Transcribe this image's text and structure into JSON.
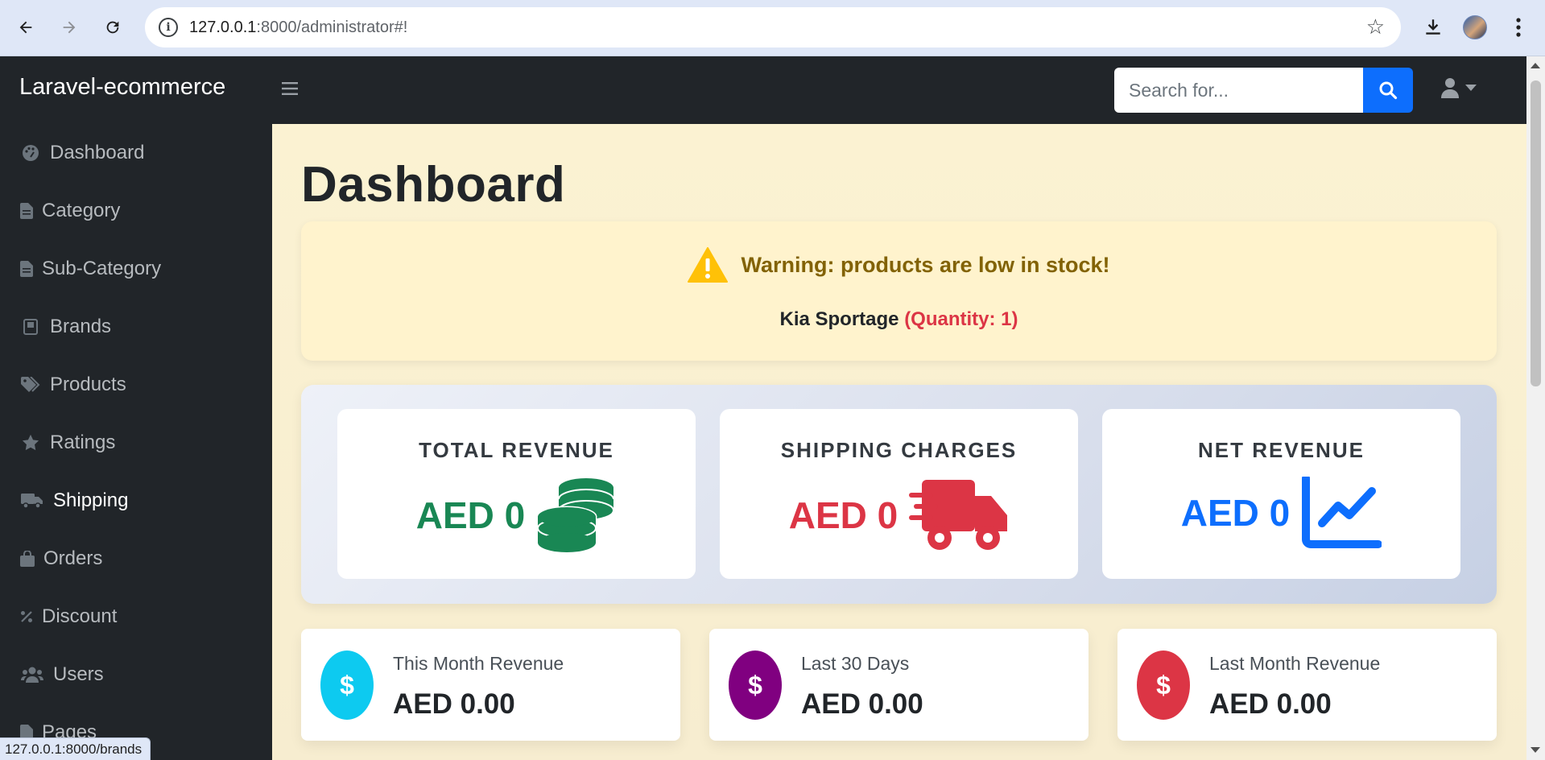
{
  "browser": {
    "url_host": "127.0.0.1",
    "url_path": ":8000/administrator#!",
    "status_url": "127.0.0.1:8000/brands"
  },
  "app": {
    "brand": "Laravel-ecommerce",
    "search_placeholder": "Search for..."
  },
  "sidebar": {
    "items": [
      {
        "label": "Dashboard",
        "icon": "palette-icon"
      },
      {
        "label": "Category",
        "icon": "file-icon"
      },
      {
        "label": "Sub-Category",
        "icon": "file-icon"
      },
      {
        "label": "Brands",
        "icon": "book-icon"
      },
      {
        "label": "Products",
        "icon": "tags-icon"
      },
      {
        "label": "Ratings",
        "icon": "star-icon"
      },
      {
        "label": "Shipping",
        "icon": "truck-icon",
        "active": true
      },
      {
        "label": "Orders",
        "icon": "bag-icon"
      },
      {
        "label": "Discount",
        "icon": "percent-icon"
      },
      {
        "label": "Users",
        "icon": "users-icon"
      },
      {
        "label": "Pages",
        "icon": "file-icon"
      }
    ]
  },
  "main": {
    "title": "Dashboard",
    "alert": {
      "title": "Warning: products are low in stock!",
      "product": "Kia Sportage",
      "quantity": "(Quantity: 1)"
    },
    "revenue_cards": [
      {
        "label": "TOTAL REVENUE",
        "value": "AED 0",
        "color": "#198754",
        "icon": "coins-icon"
      },
      {
        "label": "SHIPPING CHARGES",
        "value": "AED 0",
        "color": "#dc3545",
        "icon": "shipping-fast-icon"
      },
      {
        "label": "NET REVENUE",
        "value": "AED 0",
        "color": "#0d6efd",
        "icon": "chart-line-icon"
      }
    ],
    "mini_cards": [
      {
        "label": "This Month Revenue",
        "value": "AED 0.00",
        "color": "#0dcaf0",
        "icon_glyph": "$"
      },
      {
        "label": "Last 30 Days",
        "value": "AED 0.00",
        "color": "#800080",
        "icon_glyph": "$"
      },
      {
        "label": "Last Month Revenue",
        "value": "AED 0.00",
        "color": "#dc3545",
        "icon_glyph": "$"
      }
    ]
  }
}
